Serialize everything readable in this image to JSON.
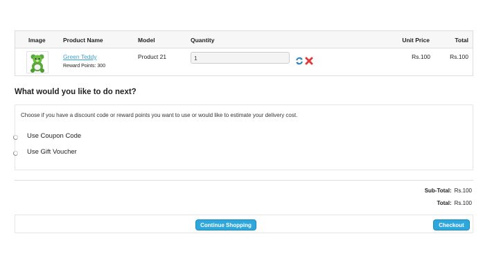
{
  "cart": {
    "headers": {
      "image": "Image",
      "product_name": "Product Name",
      "model": "Model",
      "quantity": "Quantity",
      "unit_price": "Unit Price",
      "total": "Total"
    },
    "items": [
      {
        "name": "Green Teddy",
        "reward_points": "Reward Points: 300",
        "model": "Product 21",
        "quantity": "1",
        "unit_price": "Rs.100",
        "total": "Rs.100"
      }
    ]
  },
  "next": {
    "title": "What would you like to do next?",
    "description": "Choose if you have a discount code or reward points you want to use or would like to estimate your delivery cost.",
    "options": [
      "Use Coupon Code",
      "Use Gift Voucher"
    ]
  },
  "totals": {
    "subtotal_label": "Sub-Total:",
    "subtotal_value": "Rs.100",
    "total_label": "Total:",
    "total_value": "Rs.100"
  },
  "buttons": {
    "continue": "Continue Shopping",
    "checkout": "Checkout"
  },
  "icons": {
    "update": "refresh-icon",
    "remove": "remove-icon"
  },
  "colors": {
    "accent": "#2ea8dc",
    "link": "#38a4d0",
    "remove": "#e03a3a"
  }
}
